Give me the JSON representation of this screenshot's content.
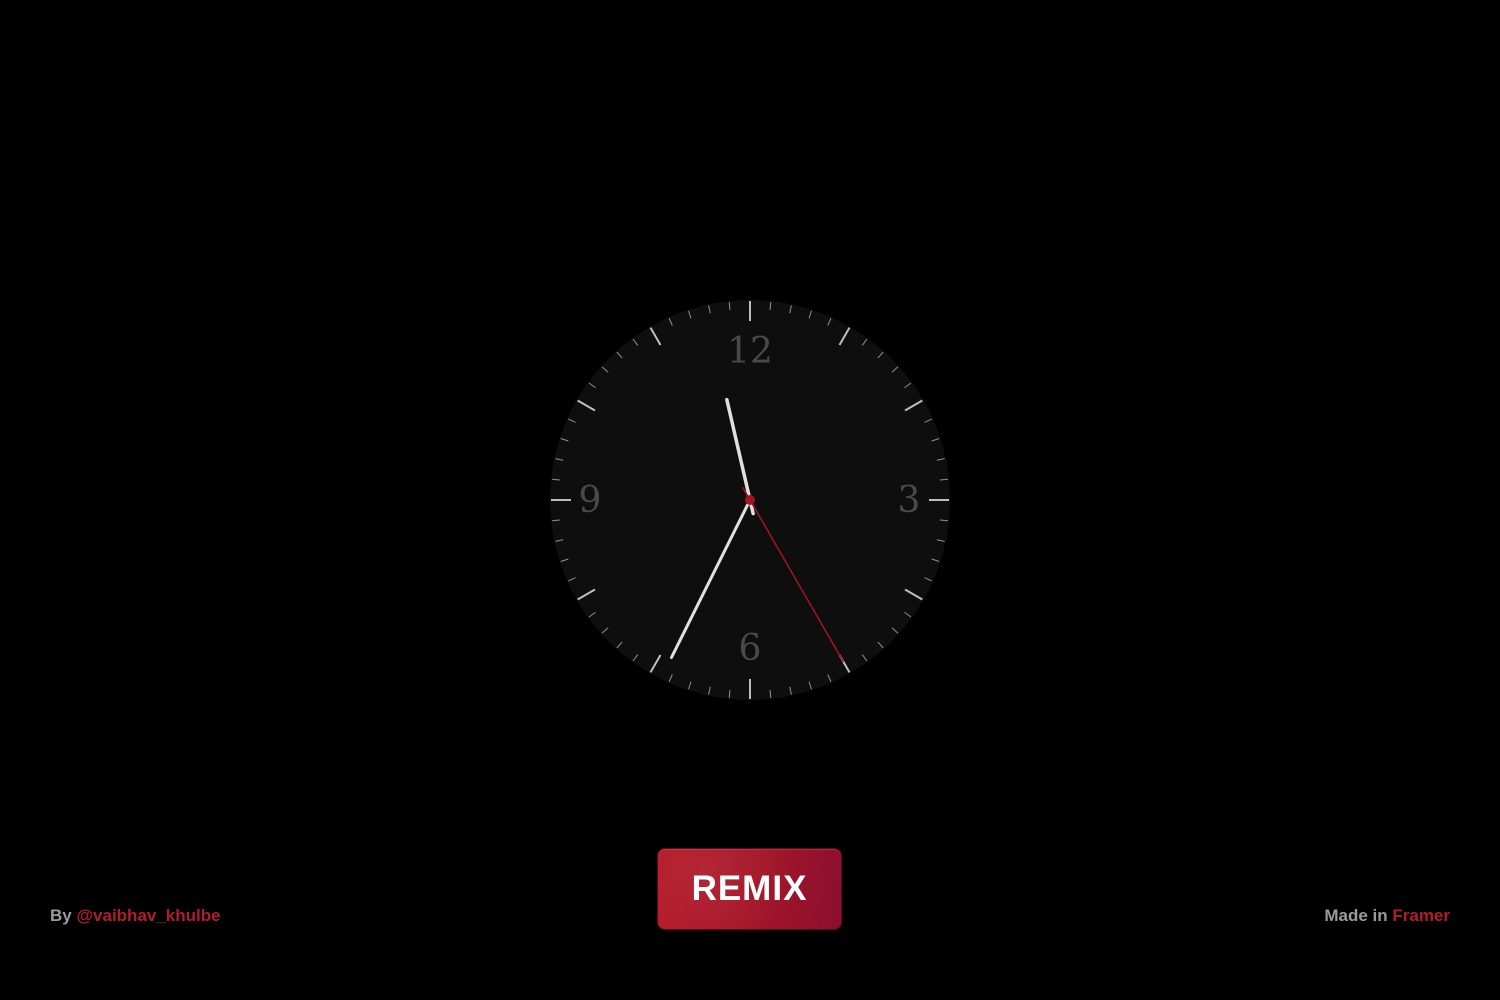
{
  "clock": {
    "numerals": [
      "12",
      "3",
      "6",
      "9"
    ],
    "time": {
      "hours": 11,
      "minutes": 34,
      "seconds": 25
    },
    "colors": {
      "face": "#0e0e0e",
      "ticks": "#c8c8c8",
      "numerals": "#4a4a4a",
      "hands": "#e0e0e0",
      "second_hand": "#a31524"
    }
  },
  "remix_button": {
    "label": "REMIX"
  },
  "footer": {
    "by_prefix": "By",
    "author": "@vaibhav_khulbe",
    "made_prefix": "Made in",
    "made_brand": "Framer"
  },
  "colors": {
    "background": "#000000",
    "accent": "#b01e2c",
    "muted_text": "#9a9a9a"
  }
}
